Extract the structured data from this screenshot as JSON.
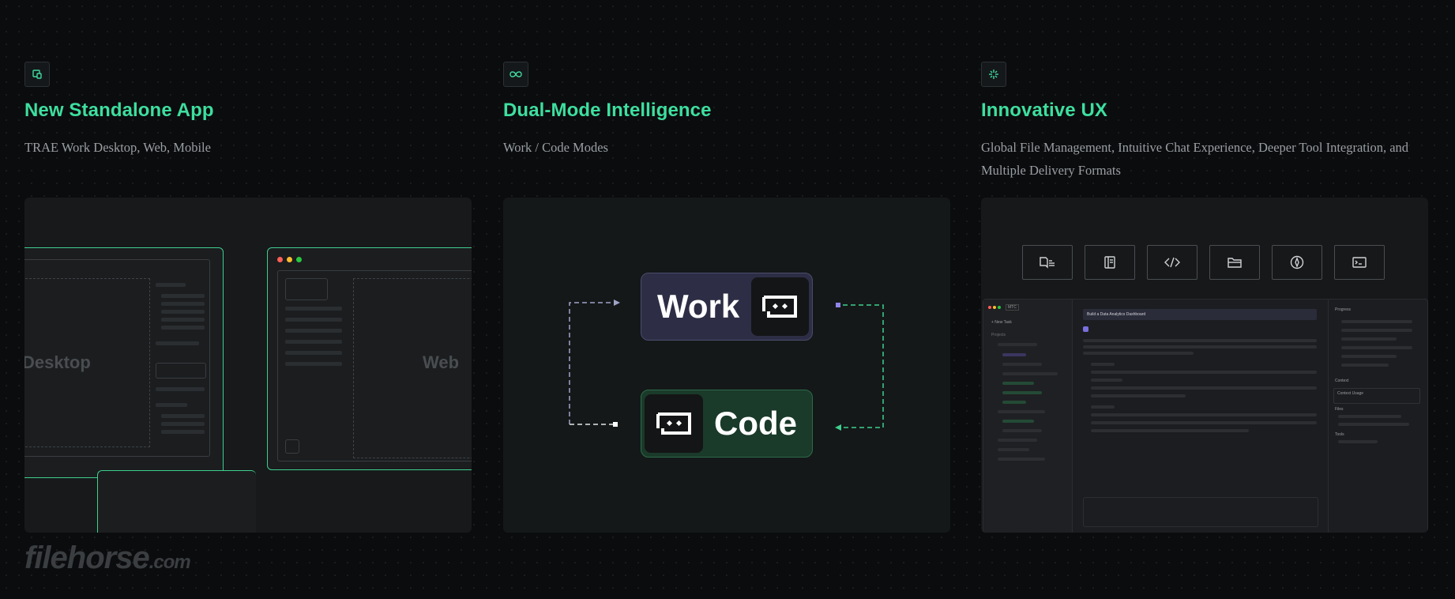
{
  "features": [
    {
      "title": "New Standalone App",
      "desc": "TRAE Work Desktop, Web, Mobile",
      "icon": "device-icon"
    },
    {
      "title": "Dual-Mode Intelligence",
      "desc": "Work / Code Modes",
      "icon": "infinity-icon"
    },
    {
      "title": "Innovative UX",
      "desc": "Global File Management, Intuitive Chat Experience, Deeper Tool Integration, and Multiple Delivery Formats",
      "icon": "sparkle-icon"
    }
  ],
  "card1": {
    "desktop_label": "Desktop",
    "web_label": "Web"
  },
  "card2": {
    "work_label": "Work",
    "code_label": "Code",
    "work_color": "#2d2e45",
    "code_color": "#1a3a2a"
  },
  "card3": {
    "tools": [
      "book-icon",
      "document-icon",
      "code-icon",
      "folder-icon",
      "compass-icon",
      "terminal-icon"
    ],
    "mini_ui": {
      "tab_label": "MTC",
      "new_task": "+ New Task",
      "projects_label": "Projects",
      "prompt": "Build a Data Analytics Dashboard",
      "progress_label": "Progress",
      "context_label": "Context",
      "context_item": "Context Usage",
      "files_label": "Files",
      "tools_label": "Tools"
    }
  },
  "watermark": {
    "brand": "filehorse",
    "suffix": ".com"
  },
  "colors": {
    "accent": "#3ddf9f",
    "background": "#0b0c0e",
    "card": "#17191b"
  }
}
